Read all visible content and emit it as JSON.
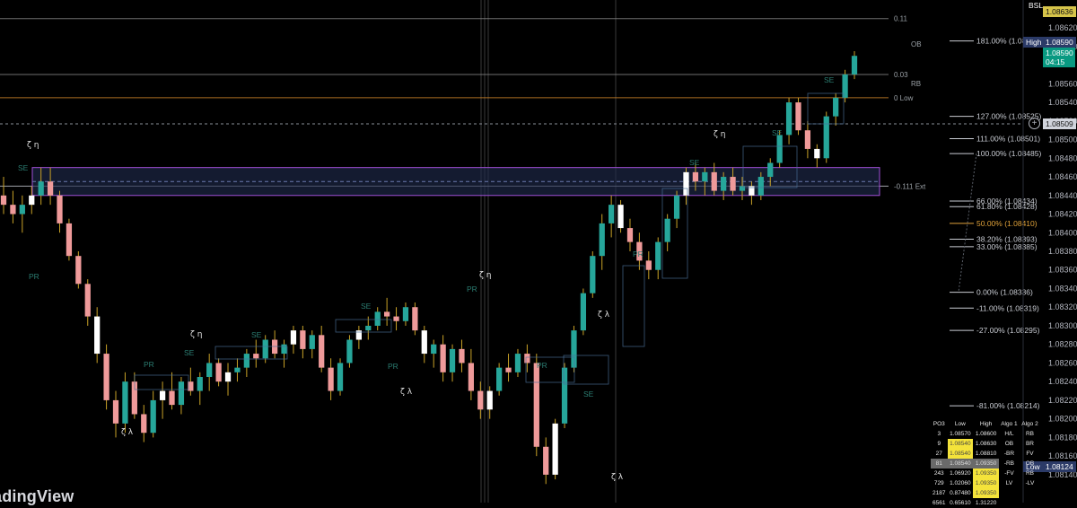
{
  "app": {
    "watermark": "adingView"
  },
  "price_axis": {
    "ticks": [
      "1.08620",
      "1.08600",
      "1.08560",
      "1.08540",
      "1.08520",
      "1.08500",
      "1.08480",
      "1.08460",
      "1.08440",
      "1.08420",
      "1.08400",
      "1.08380",
      "1.08360",
      "1.08340",
      "1.08320",
      "1.08300",
      "1.08280",
      "1.08260",
      "1.08240",
      "1.08220",
      "1.08200",
      "1.08180",
      "1.08160",
      "1.08140"
    ],
    "bsl_label": "BSL",
    "bsl_value": "1.08636",
    "high_label": "High",
    "high_value": "1.08590",
    "last_price": "1.08590",
    "countdown": "04:15",
    "crosshair_value": "1.08509",
    "low_label": "Low",
    "low_value": "1.08124",
    "colors": {
      "bsl": "#d6c44a",
      "high": "#2b3a67",
      "last": "#089981",
      "low": "#2b3a67"
    }
  },
  "chart_data": {
    "type": "candlestick",
    "symbol_hint": "",
    "ylim": [
      1.0811,
      1.0865
    ],
    "colors": {
      "up": "#26a69a",
      "down": "#ef9a9a",
      "neutral": "#ffffff",
      "wick": "#c9a227"
    },
    "candles": [
      [
        1.0844,
        1.0846,
        1.0842,
        1.0843
      ],
      [
        1.0843,
        1.08445,
        1.0841,
        1.0842
      ],
      [
        1.0842,
        1.0844,
        1.084,
        1.0843
      ],
      [
        1.0843,
        1.0845,
        1.0842,
        1.0844
      ],
      [
        1.0844,
        1.0847,
        1.0843,
        1.08455
      ],
      [
        1.08455,
        1.0847,
        1.0843,
        1.0844
      ],
      [
        1.0844,
        1.08445,
        1.084,
        1.0841
      ],
      [
        1.0841,
        1.08415,
        1.0837,
        1.08375
      ],
      [
        1.08375,
        1.0838,
        1.0834,
        1.08345
      ],
      [
        1.08345,
        1.0835,
        1.083,
        1.0831
      ],
      [
        1.0831,
        1.0832,
        1.0826,
        1.0827
      ],
      [
        1.0827,
        1.0828,
        1.0821,
        1.0822
      ],
      [
        1.0822,
        1.0823,
        1.0818,
        1.08195
      ],
      [
        1.08195,
        1.0825,
        1.08185,
        1.0824
      ],
      [
        1.0824,
        1.0825,
        1.082,
        1.08205
      ],
      [
        1.08205,
        1.08215,
        1.08175,
        1.08185
      ],
      [
        1.08185,
        1.0823,
        1.0818,
        1.0822
      ],
      [
        1.0822,
        1.0824,
        1.082,
        1.0823
      ],
      [
        1.0823,
        1.0825,
        1.0821,
        1.08215
      ],
      [
        1.08215,
        1.08245,
        1.08205,
        1.0824
      ],
      [
        1.0824,
        1.08255,
        1.08225,
        1.0823
      ],
      [
        1.0823,
        1.0825,
        1.08215,
        1.08245
      ],
      [
        1.08245,
        1.0827,
        1.0823,
        1.0826
      ],
      [
        1.0826,
        1.08265,
        1.08235,
        1.0824
      ],
      [
        1.0824,
        1.0826,
        1.08225,
        1.0825
      ],
      [
        1.0825,
        1.08265,
        1.0824,
        1.08255
      ],
      [
        1.08255,
        1.08275,
        1.08245,
        1.0827
      ],
      [
        1.0827,
        1.08285,
        1.08255,
        1.08265
      ],
      [
        1.08265,
        1.0829,
        1.0826,
        1.08285
      ],
      [
        1.08285,
        1.08295,
        1.08265,
        1.0827
      ],
      [
        1.0827,
        1.08285,
        1.08255,
        1.0828
      ],
      [
        1.0828,
        1.083,
        1.0827,
        1.08295
      ],
      [
        1.08295,
        1.083,
        1.08265,
        1.08275
      ],
      [
        1.08275,
        1.08295,
        1.08265,
        1.0829
      ],
      [
        1.0829,
        1.083,
        1.0825,
        1.08255
      ],
      [
        1.08255,
        1.08265,
        1.0822,
        1.0823
      ],
      [
        1.0823,
        1.08265,
        1.08225,
        1.0826
      ],
      [
        1.0826,
        1.0829,
        1.08255,
        1.08285
      ],
      [
        1.08285,
        1.083,
        1.08275,
        1.08295
      ],
      [
        1.08295,
        1.0831,
        1.08285,
        1.083
      ],
      [
        1.083,
        1.0832,
        1.08295,
        1.08315
      ],
      [
        1.08315,
        1.0833,
        1.083,
        1.0831
      ],
      [
        1.0831,
        1.0832,
        1.08295,
        1.08305
      ],
      [
        1.08305,
        1.08325,
        1.083,
        1.0832
      ],
      [
        1.0832,
        1.08325,
        1.0829,
        1.08295
      ],
      [
        1.08295,
        1.083,
        1.0826,
        1.0827
      ],
      [
        1.0827,
        1.08285,
        1.08255,
        1.0828
      ],
      [
        1.0828,
        1.0829,
        1.0824,
        1.0825
      ],
      [
        1.0825,
        1.0828,
        1.0824,
        1.08275
      ],
      [
        1.08275,
        1.08285,
        1.0825,
        1.0826
      ],
      [
        1.0826,
        1.08275,
        1.0822,
        1.0823
      ],
      [
        1.0823,
        1.0824,
        1.082,
        1.0821
      ],
      [
        1.0821,
        1.08235,
        1.082,
        1.0823
      ],
      [
        1.0823,
        1.0826,
        1.08225,
        1.08255
      ],
      [
        1.08255,
        1.0827,
        1.0824,
        1.0825
      ],
      [
        1.0825,
        1.08275,
        1.08245,
        1.0827
      ],
      [
        1.0827,
        1.0828,
        1.0825,
        1.0826
      ],
      [
        1.0826,
        1.0827,
        1.0816,
        1.0817
      ],
      [
        1.0817,
        1.0818,
        1.0813,
        1.0814
      ],
      [
        1.0814,
        1.082,
        1.08135,
        1.08195
      ],
      [
        1.08195,
        1.0826,
        1.0819,
        1.08255
      ],
      [
        1.08255,
        1.083,
        1.0825,
        1.08295
      ],
      [
        1.08295,
        1.0834,
        1.0829,
        1.08335
      ],
      [
        1.08335,
        1.0838,
        1.0833,
        1.08375
      ],
      [
        1.08375,
        1.0842,
        1.0836,
        1.0841
      ],
      [
        1.0841,
        1.0844,
        1.08395,
        1.0843
      ],
      [
        1.0843,
        1.08435,
        1.084,
        1.08405
      ],
      [
        1.08405,
        1.08415,
        1.0838,
        1.0839
      ],
      [
        1.0839,
        1.084,
        1.0836,
        1.0837
      ],
      [
        1.0837,
        1.0838,
        1.0835,
        1.0836
      ],
      [
        1.0836,
        1.08395,
        1.0835,
        1.0839
      ],
      [
        1.0839,
        1.0842,
        1.0838,
        1.08415
      ],
      [
        1.08415,
        1.08445,
        1.08405,
        1.0844
      ],
      [
        1.0844,
        1.0847,
        1.0843,
        1.08465
      ],
      [
        1.08465,
        1.08475,
        1.08445,
        1.08455
      ],
      [
        1.08455,
        1.0847,
        1.0844,
        1.08465
      ],
      [
        1.08465,
        1.08475,
        1.0844,
        1.08445
      ],
      [
        1.08445,
        1.08465,
        1.08435,
        1.0846
      ],
      [
        1.0846,
        1.0847,
        1.0844,
        1.08445
      ],
      [
        1.08445,
        1.0846,
        1.08435,
        1.0845
      ],
      [
        1.0845,
        1.08455,
        1.0843,
        1.0844
      ],
      [
        1.0844,
        1.08465,
        1.08435,
        1.0846
      ],
      [
        1.0846,
        1.0848,
        1.0845,
        1.08475
      ],
      [
        1.08475,
        1.0851,
        1.0847,
        1.08505
      ],
      [
        1.08505,
        1.08545,
        1.08495,
        1.0854
      ],
      [
        1.0854,
        1.08545,
        1.08505,
        1.0851
      ],
      [
        1.0851,
        1.0852,
        1.0848,
        1.0849
      ],
      [
        1.0849,
        1.08495,
        1.0847,
        1.0848
      ],
      [
        1.0848,
        1.0853,
        1.08475,
        1.08525
      ],
      [
        1.08525,
        1.0855,
        1.08515,
        1.08545
      ],
      [
        1.08545,
        1.08575,
        1.0854,
        1.0857
      ],
      [
        1.0857,
        1.08595,
        1.08565,
        1.0859
      ]
    ],
    "fib_levels": [
      {
        "label": "181.00% (1.08606)",
        "price": 1.08606,
        "color": "#c9ccd3"
      },
      {
        "label": "127.00% (1.08525)",
        "price": 1.08525,
        "color": "#c9ccd3"
      },
      {
        "label": "111.00% (1.08501)",
        "price": 1.08501,
        "color": "#c9ccd3"
      },
      {
        "label": "100.00% (1.08485)",
        "price": 1.08485,
        "color": "#c9ccd3"
      },
      {
        "label": "66.00% (1.08434)",
        "price": 1.08434,
        "color": "#c9ccd3"
      },
      {
        "label": "61.80% (1.08428)",
        "price": 1.08428,
        "color": "#c9ccd3"
      },
      {
        "label": "50.00% (1.08410)",
        "price": 1.0841,
        "color": "#e0a23a"
      },
      {
        "label": "38.20% (1.08393)",
        "price": 1.08393,
        "color": "#c9ccd3"
      },
      {
        "label": "33.00% (1.08385)",
        "price": 1.08385,
        "color": "#c9ccd3"
      },
      {
        "label": "0.00% (1.08336)",
        "price": 1.08336,
        "color": "#c9ccd3"
      },
      {
        "label": "-11.00% (1.08319)",
        "price": 1.08319,
        "color": "#c9ccd3"
      },
      {
        "label": "-27.00% (1.08295)",
        "price": 1.08295,
        "color": "#c9ccd3"
      },
      {
        "label": "-81.00% (1.08214)",
        "price": 1.08214,
        "color": "#c9ccd3"
      }
    ],
    "horizontal_lines": [
      {
        "label": "0.11",
        "price": 1.0863,
        "color": "#8a8a8a"
      },
      {
        "label": "0.03",
        "price": 1.0857,
        "color": "#8a8a8a"
      },
      {
        "label": "0 Low",
        "price": 1.08545,
        "color": "#d98a2b"
      },
      {
        "label": "-0.111 Ext",
        "price": 1.0845,
        "color": "#c9ccd3"
      }
    ],
    "small_tags": [
      "OB",
      "RB"
    ],
    "order_block_zone": {
      "from": 1.0847,
      "to": 1.0844,
      "border": "#a24fd8",
      "fill": "#1e2a4a"
    },
    "annotations": {
      "zeta_high": "ζ η",
      "zeta_low": "ζ λ",
      "se": "SE",
      "pr": "PR"
    }
  },
  "algo_table": {
    "headers": [
      "PO3",
      "Low",
      "High",
      "Algo 1",
      "Algo 2"
    ],
    "rows": [
      [
        "3",
        "1.08570",
        "1.08600",
        "H/L",
        "RB"
      ],
      [
        "9",
        "1.08540",
        "1.08630",
        "OB",
        "BR"
      ],
      [
        "27",
        "1.08540",
        "1.08810",
        "-BR",
        "FV"
      ],
      [
        "81",
        "1.08540",
        "1.09350",
        "-RB",
        "OB"
      ],
      [
        "243",
        "1.06920",
        "1.09350",
        "-FV",
        "RB"
      ],
      [
        "729",
        "1.02060",
        "1.09350",
        "LV",
        "-LV"
      ],
      [
        "2187",
        "0.87480",
        "1.09350",
        "",
        ""
      ],
      [
        "6561",
        "0.65610",
        "1.31220",
        "",
        ""
      ]
    ],
    "highlight": {
      "low_yellow_rows": [
        1,
        2
      ],
      "high_yellow_rows": [
        4,
        5,
        6
      ],
      "grey_row": 3
    }
  }
}
